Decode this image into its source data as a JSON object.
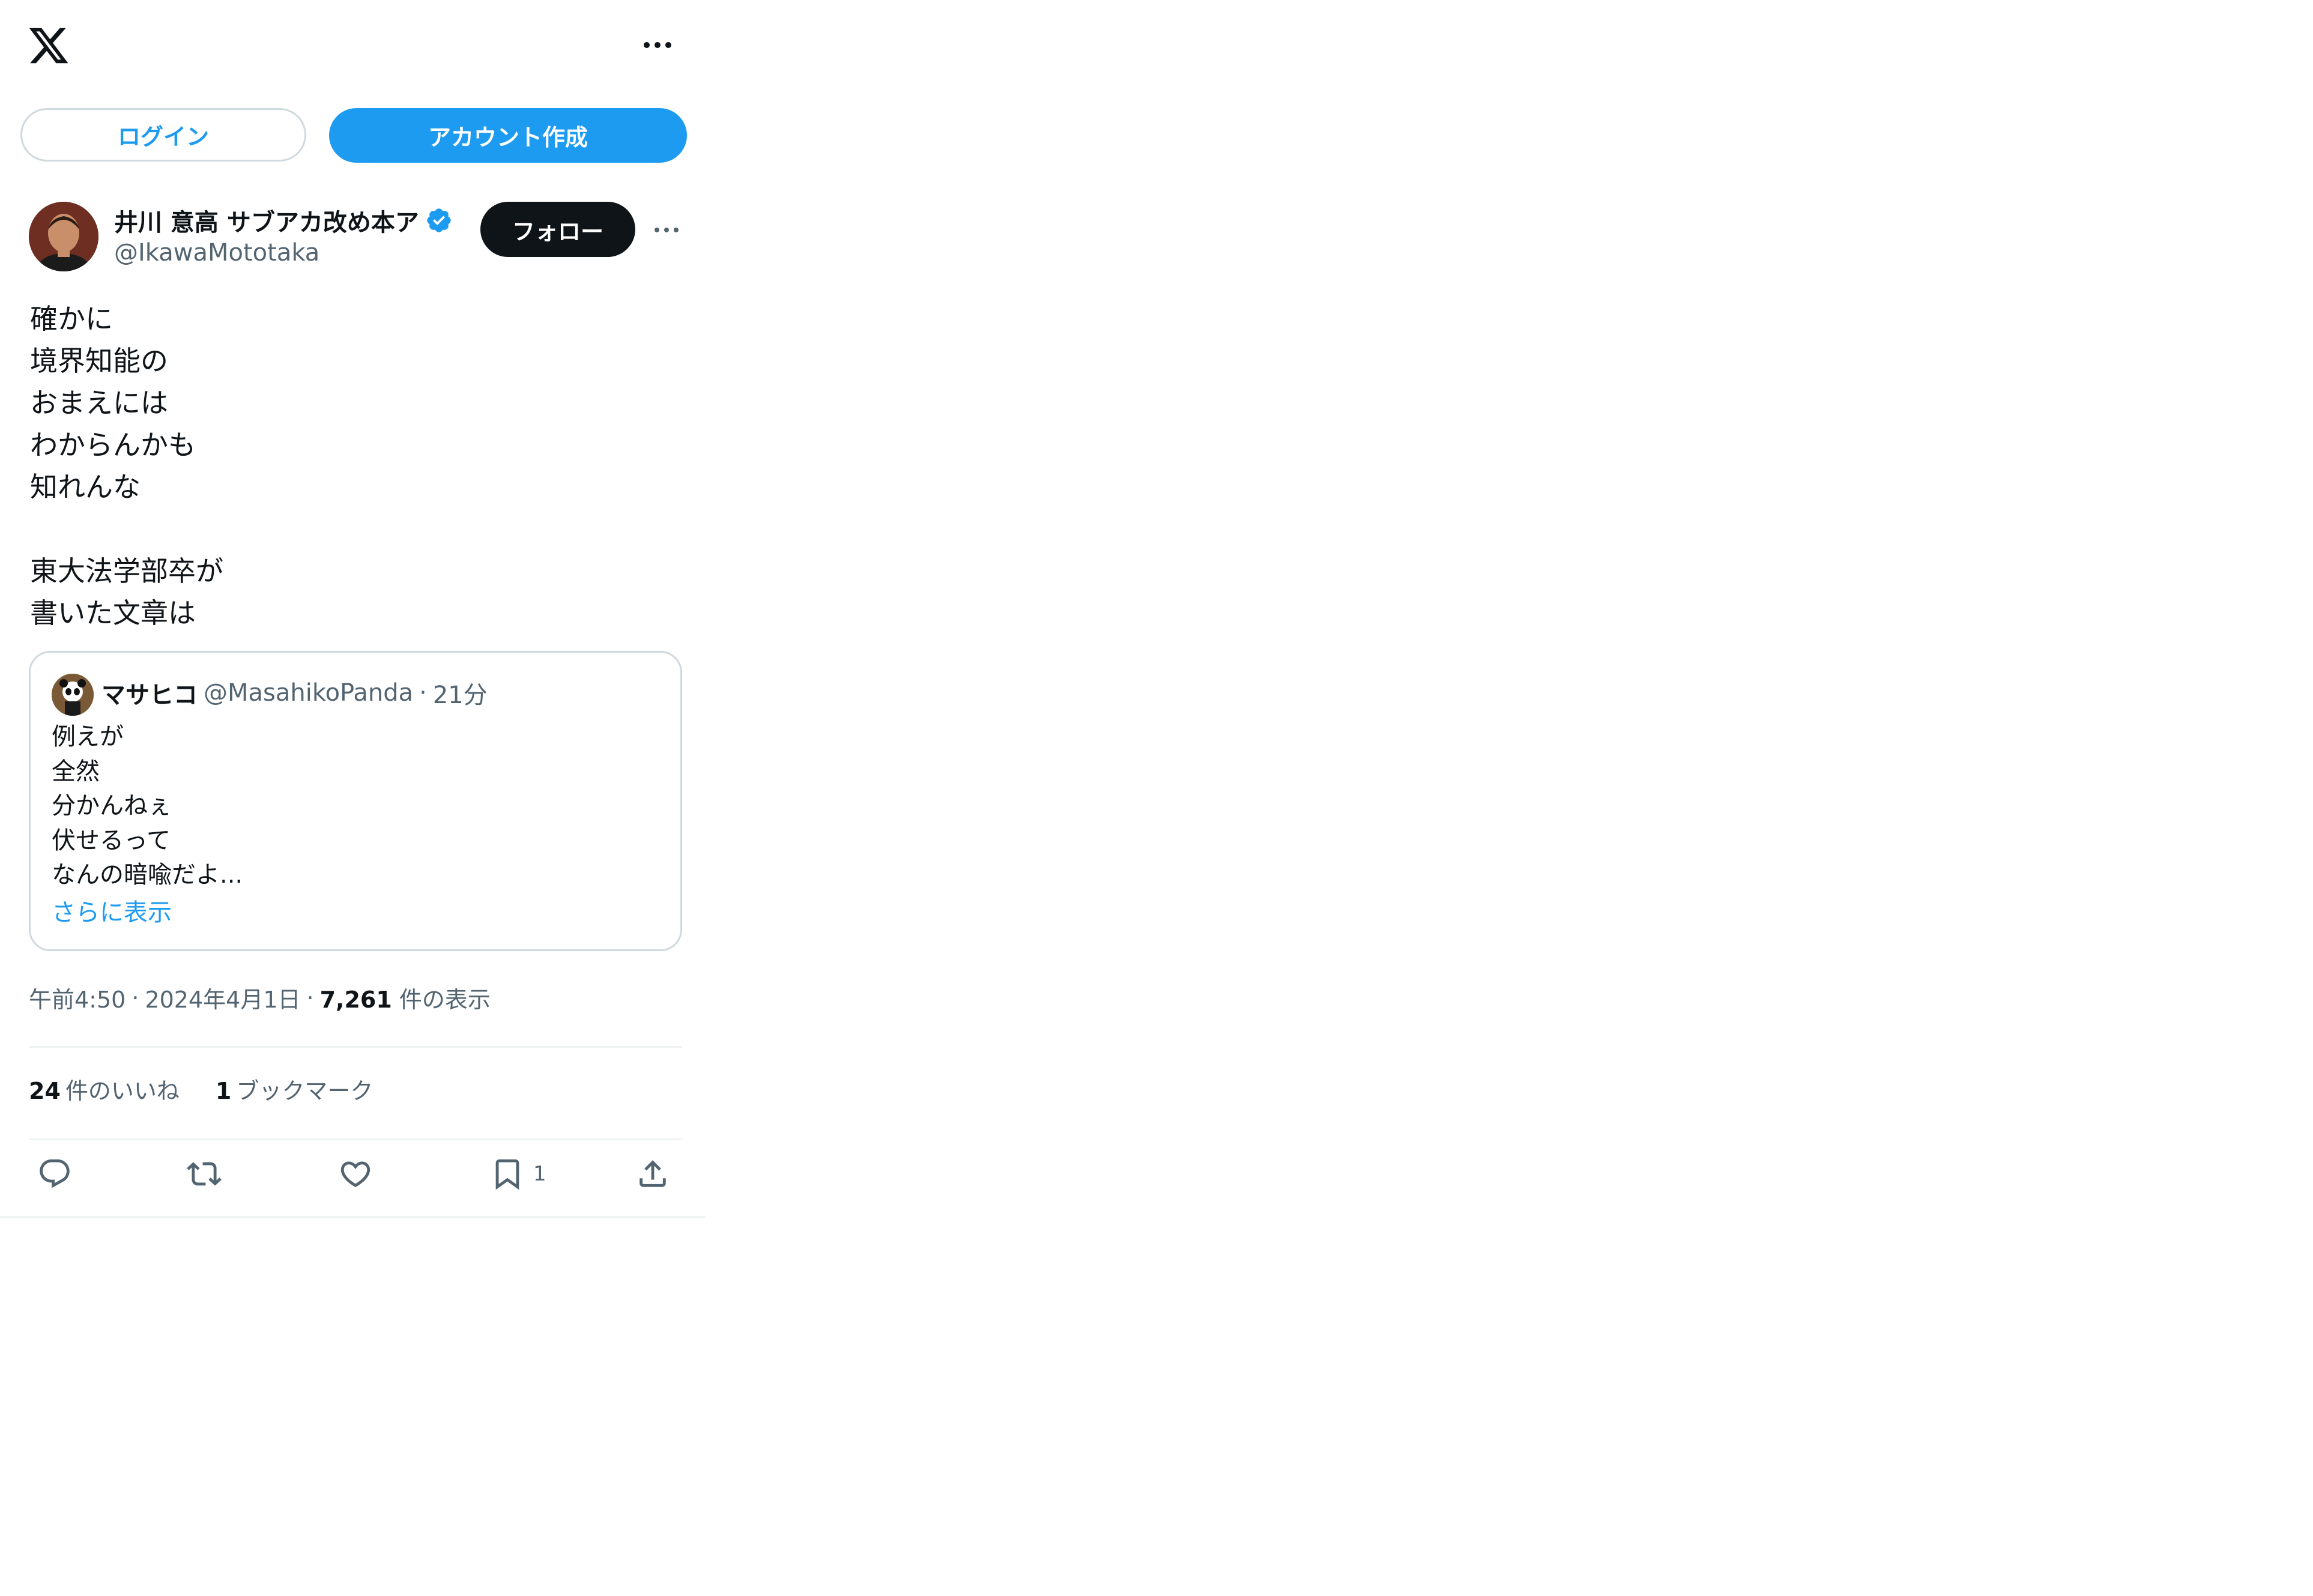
{
  "header": {
    "logo_icon": "x-logo-icon",
    "more_icon": "more-horizontal-icon"
  },
  "auth": {
    "login_label": "ログイン",
    "signup_label": "アカウント作成"
  },
  "tweet": {
    "author_name": "井川 意高 サブアカ改め本ア",
    "verified_icon": "verified-badge-icon",
    "author_handle": "@IkawaMototaka",
    "follow_label": "フォロー",
    "text": "確かに\n境界知能の\nおまえには\nわからんかも\n知れんな\n\n東大法学部卒が\n書いた文章は",
    "quote": {
      "name": "マサヒコ",
      "handle": "@MasahikoPanda",
      "separator": "·",
      "time": "21分",
      "text": "例えが\n全然\n分かんねぇ\n伏せるって\nなんの暗喩だよ...",
      "show_more": "さらに表示"
    },
    "meta": {
      "time": "午前4:50",
      "sep1": "·",
      "date": "2024年4月1日",
      "sep2": "·",
      "views_count": "7,261",
      "views_label": "件の表示"
    },
    "stats": {
      "likes_count": "24",
      "likes_label": "件のいいね",
      "bookmarks_count": "1",
      "bookmarks_label": "ブックマーク"
    },
    "actions": {
      "reply_icon": "reply-icon",
      "retweet_icon": "retweet-icon",
      "like_icon": "heart-icon",
      "bookmark_icon": "bookmark-icon",
      "bookmark_count": "1",
      "share_icon": "share-icon"
    }
  },
  "colors": {
    "accent": "#1d9bf0",
    "text": "#0f1419",
    "secondary": "#536471",
    "border": "#cfd9de",
    "divider": "#eff3f4"
  }
}
